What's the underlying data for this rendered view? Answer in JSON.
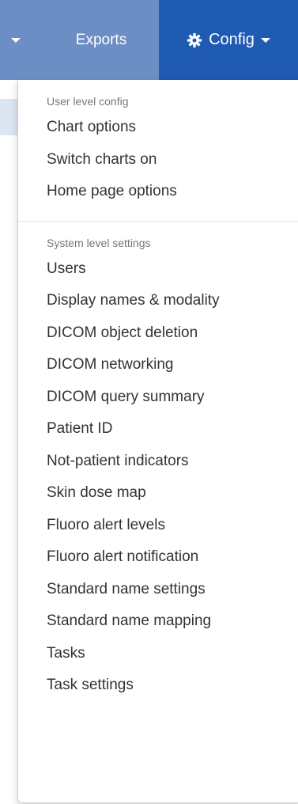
{
  "navbar": {
    "exports_label": "Exports",
    "config_label": "Config",
    "config_icon": "gear-icon",
    "colors": {
      "navbar_bg": "#6c8ec4",
      "config_bg": "#1f5bb3"
    }
  },
  "menu": {
    "user_header": "User level config",
    "user_items": [
      "Chart options",
      "Switch charts on",
      "Home page options"
    ],
    "system_header": "System level settings",
    "system_items": [
      "Users",
      "Display names & modality",
      "DICOM object deletion",
      "DICOM networking",
      "DICOM query summary",
      "Patient ID",
      "Not-patient indicators",
      "Skin dose map",
      "Fluoro alert levels",
      "Fluoro alert notification",
      "Standard name settings",
      "Standard name mapping",
      "Tasks",
      "Task settings"
    ]
  }
}
